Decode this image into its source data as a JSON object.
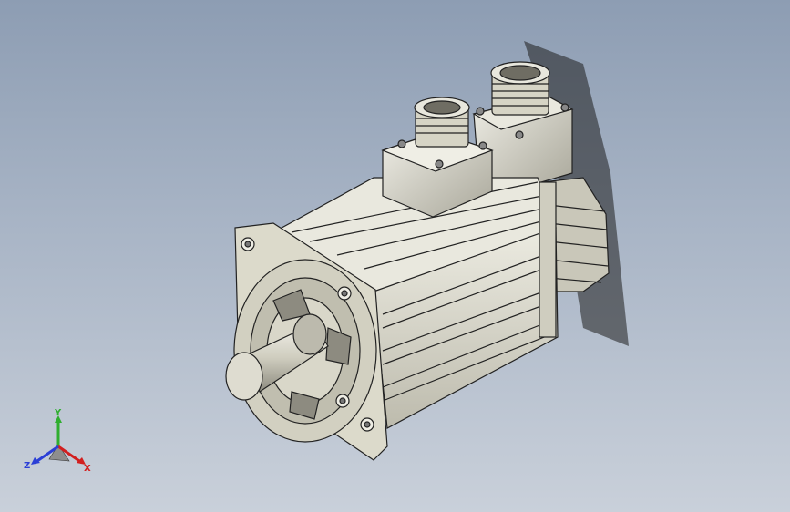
{
  "viewport": {
    "background_top": "#8d9db3",
    "background_bottom": "#c9d0da",
    "part_color": "#d8d6c8",
    "edge_color": "#222222"
  },
  "model": {
    "icon": "servo-motor-model"
  },
  "triad": {
    "x_label": "X",
    "y_label": "Y",
    "z_label": "Z",
    "x_color": "#d21f1f",
    "y_color": "#2fae2f",
    "z_color": "#2b3fd6"
  }
}
